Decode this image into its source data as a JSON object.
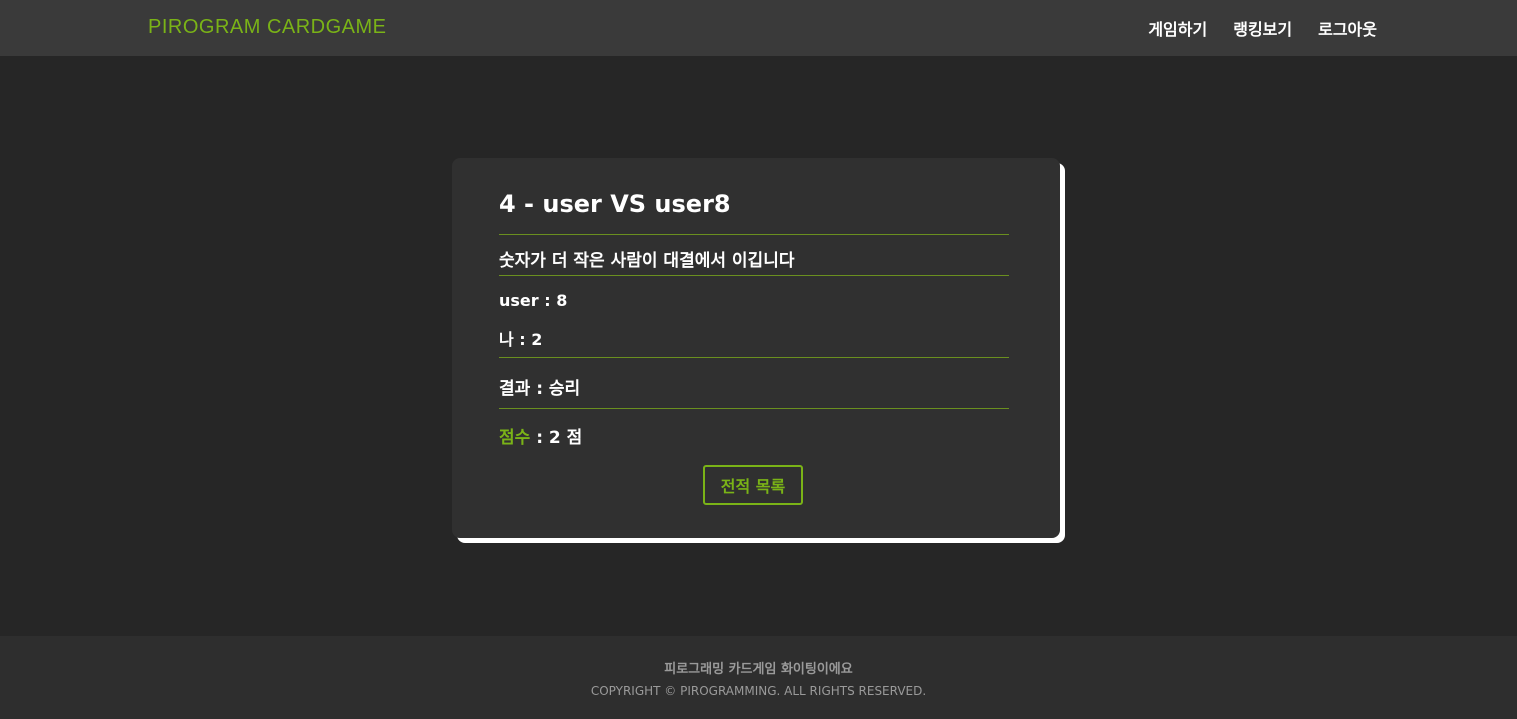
{
  "header": {
    "brand": "PIROGRAM CARDGAME",
    "nav": [
      {
        "label": "게임하기"
      },
      {
        "label": "랭킹보기"
      },
      {
        "label": "로그아웃"
      }
    ]
  },
  "game": {
    "title": "4 - user VS user8",
    "rule": "숫자가 더 작은 사람이 대결에서 이깁니다",
    "opponent_score": "user : 8",
    "my_score": "나 : 2",
    "result": "결과 : 승리",
    "points_label": "점수",
    "points_value": " : 2 점",
    "back_button": "전적 목록"
  },
  "footer": {
    "line1": "피로그래밍 카드게임 화이팅이에요",
    "line2": "COPYRIGHT © PIROGRAMMING. ALL RIGHTS RESERVED."
  },
  "colors": {
    "accent": "#7ab317",
    "background": "#262626",
    "card": "#303030",
    "text": "#ffffff"
  }
}
